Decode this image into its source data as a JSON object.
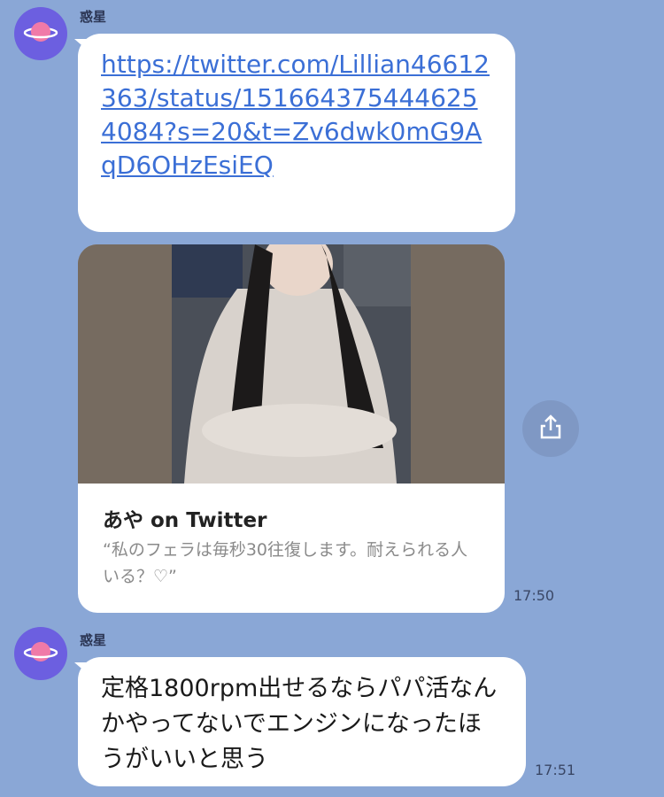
{
  "messages": [
    {
      "sender": "惑星",
      "link": "https://twitter.com/Lillian46612363/status/1516643754446254084?s=20&t=Zv6dwk0mG9AqD6OHzEsiEQ",
      "preview": {
        "title": "あや on Twitter",
        "description": "“私のフェラは毎秒30往復します。耐えられる人いる？♡”"
      },
      "time": "17:50"
    },
    {
      "sender": "惑星",
      "text": "定格1800rpm出せるならパパ活なんかやってないでエンジンになったほうがいいと思う",
      "time": "17:51"
    }
  ],
  "icons": {
    "avatar": "planet-icon",
    "share": "share-icon"
  },
  "colors": {
    "background": "#8aa7d6",
    "avatar": "#6c5fe0",
    "link": "#3b6fd6"
  }
}
